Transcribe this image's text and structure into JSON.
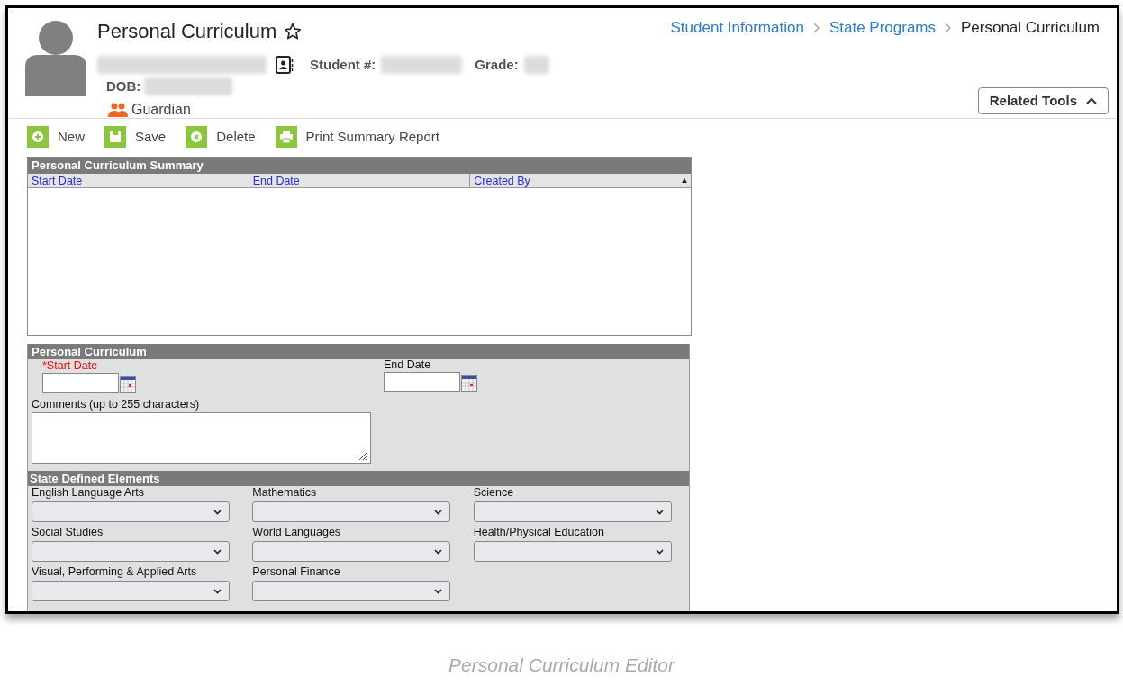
{
  "header": {
    "title": "Personal Curriculum",
    "favorite": false,
    "labels": {
      "student_number": "Student #:",
      "grade": "Grade:",
      "dob": "DOB:"
    },
    "guardian": "Guardian"
  },
  "breadcrumb": [
    {
      "label": "Student Information",
      "link": true
    },
    {
      "label": "State Programs",
      "link": true
    },
    {
      "label": "Personal Curriculum",
      "link": false
    }
  ],
  "related_tools": {
    "label": "Related Tools",
    "expanded": true
  },
  "toolbar": [
    {
      "label": "New",
      "kind": "new"
    },
    {
      "label": "Save",
      "kind": "save"
    },
    {
      "label": "Delete",
      "kind": "delete"
    },
    {
      "label": "Print Summary Report",
      "kind": "print"
    }
  ],
  "summary": {
    "title": "Personal Curriculum Summary",
    "columns": [
      {
        "label": "Start Date",
        "sorted": false
      },
      {
        "label": "End Date",
        "sorted": false
      },
      {
        "label": "Created By",
        "sorted": true
      }
    ]
  },
  "editor": {
    "title": "Personal Curriculum",
    "start_date": {
      "label": "*Start Date",
      "required": true
    },
    "end_date": {
      "label": "End Date",
      "required": false
    },
    "comments": {
      "label": "Comments (up to 255 characters)"
    }
  },
  "state_elements": {
    "title": "State Defined Elements",
    "fields": [
      {
        "label": "English Language Arts"
      },
      {
        "label": "Mathematics"
      },
      {
        "label": "Science"
      },
      {
        "label": "Social Studies"
      },
      {
        "label": "World Languages"
      },
      {
        "label": "Health/Physical Education"
      },
      {
        "label": "Visual, Performing & Applied Arts"
      },
      {
        "label": "Personal Finance"
      }
    ]
  },
  "caption": "Personal Curriculum Editor"
}
